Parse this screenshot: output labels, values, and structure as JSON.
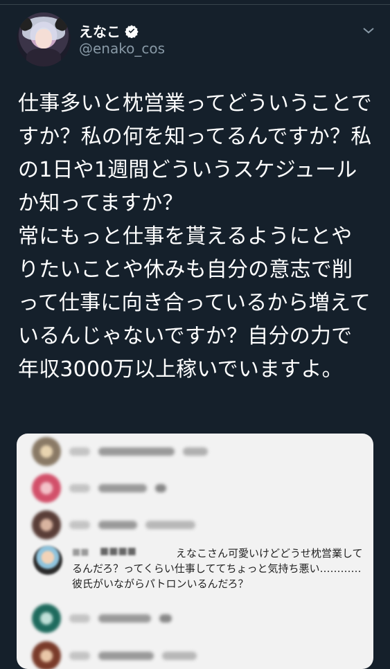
{
  "tweet": {
    "author": {
      "display_name": "えなこ",
      "handle": "@enako_cos",
      "verified": true
    },
    "text": "仕事多いと枕営業ってどういうことですか？私の何を知ってるんですか？私の1日や1週間どういうスケジュールか知ってますか？\n常にもっと仕事を貰えるようにとやりたいことや休みも自分の意志で削って仕事に向き合っているから増えているんじゃないですか？自分の力で年収3000万以上稼いでいますよ。",
    "icons": {
      "verified": "verified-badge-icon",
      "menu": "chevron-down-icon"
    }
  },
  "media": {
    "comment": {
      "text": "えなこさん可愛いけどどうせ枕営業してるんだろ？ってくらい仕事しててちょっと気持ち悪い…………彼氏がいながらパトロンいるんだろ？"
    }
  },
  "colors": {
    "background": "#15202b",
    "secondary_text": "#8899a6",
    "card_background": "#f2f2f2"
  }
}
